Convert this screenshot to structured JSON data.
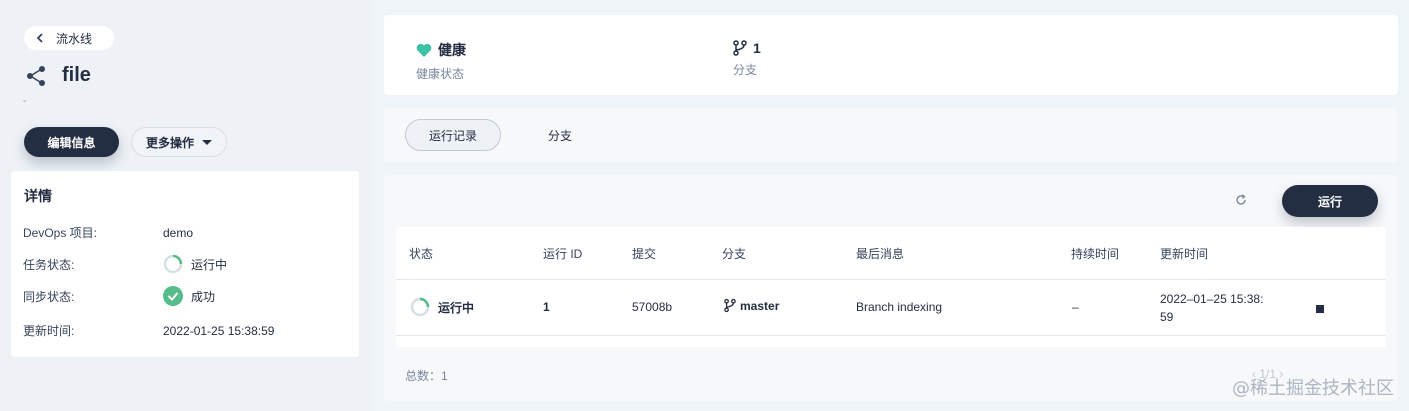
{
  "left": {
    "back_label": "流水线",
    "title": "file",
    "desc": "-",
    "edit_button": "编辑信息",
    "more_button": "更多操作",
    "details_title": "详情",
    "details": [
      {
        "key": "DevOps 项目:",
        "value": "demo"
      },
      {
        "key": "任务状态:",
        "value": "运行中",
        "icon": "running-icon"
      },
      {
        "key": "同步状态:",
        "value": "成功",
        "icon": "success-check-icon"
      },
      {
        "key": "更新时间:",
        "value": "2022-01-25 15:38:59"
      }
    ]
  },
  "status": {
    "health_value": "健康",
    "health_label": "健康状态",
    "branch_value": "1",
    "branch_label": "分支"
  },
  "tabs": [
    "运行记录",
    "分支"
  ],
  "table": {
    "run_button": "运行",
    "columns": [
      "状态",
      "运行 ID",
      "提交",
      "分支",
      "最后消息",
      "持续时间",
      "更新时间"
    ],
    "rows": [
      {
        "status": "运行中",
        "run_id": "1",
        "commit": "57008b",
        "branch": "master",
        "message": "Branch indexing",
        "duration": "–",
        "updated_line1": "2022–01–25 15:38:",
        "updated_line2": "59"
      }
    ],
    "total": "总数：1",
    "pager": "1/1"
  },
  "watermark": "@稀土掘金技术社区",
  "colors": {
    "accent": "#242e42",
    "success": "#55bc8a",
    "health": "#3ec0a3"
  }
}
